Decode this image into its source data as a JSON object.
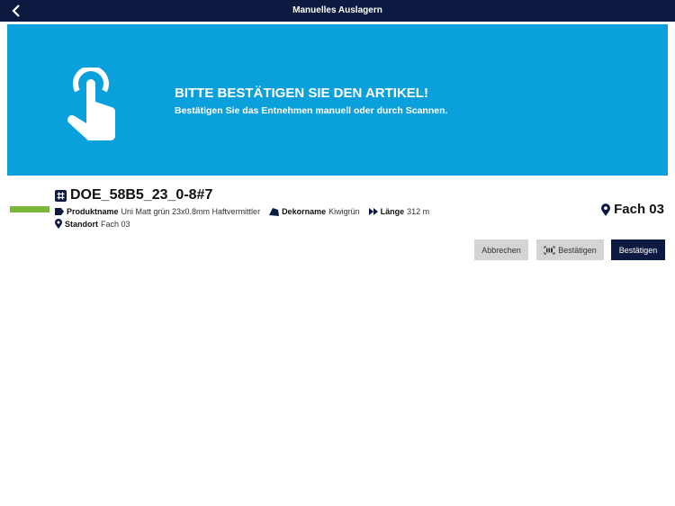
{
  "header": {
    "title": "Manuelles Auslagern"
  },
  "banner": {
    "title": "BITTE BESTÄTIGEN SIE DEN ARTIKEL!",
    "subtitle": "Bestätigen Sie das Entnehmen manuell oder durch Scannen.",
    "icon": "touch-hand-icon"
  },
  "article": {
    "id": "DOE_58B5_23_0-8#7",
    "status_color": "#7ab73a",
    "produktname_label": "Produktname",
    "produktname": "Uni Matt grün 23x0.8mm Haftvermittler",
    "dekorname_label": "Dekorname",
    "dekorname": "Kiwigrün",
    "laenge_label": "Länge",
    "laenge": "312 m",
    "standort_label": "Standort",
    "standort": "Fach 03",
    "location": "Fach 03"
  },
  "buttons": {
    "cancel": "Abbrechen",
    "scan_confirm": "Bestätigen",
    "confirm": "Bestätigen"
  }
}
